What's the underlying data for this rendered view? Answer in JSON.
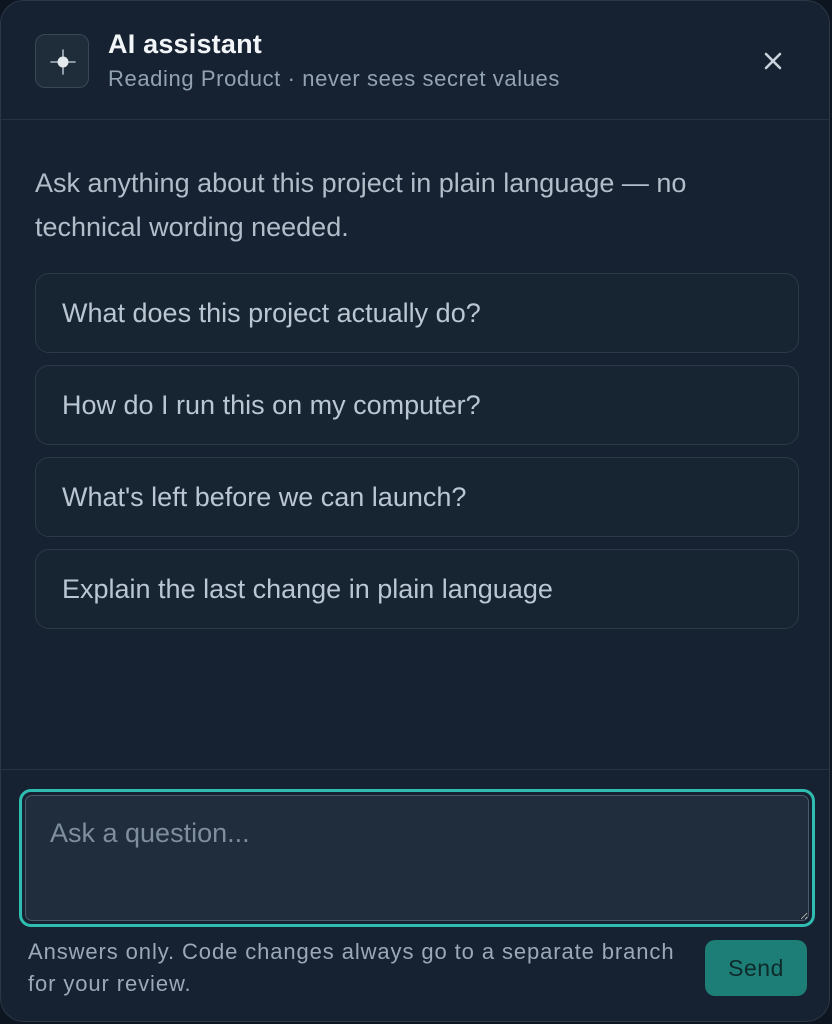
{
  "header": {
    "title": "AI assistant",
    "subtitle": "Reading Product · never sees secret values",
    "logo_icon": "sparkle-icon",
    "close_icon": "close-icon"
  },
  "intro": "Ask anything about this project in plain language — no technical wording needed.",
  "suggestions": [
    "What does this project actually do?",
    "How do I run this on my computer?",
    "What's left before we can launch?",
    "Explain the last change in plain language"
  ],
  "composer": {
    "placeholder": "Ask a question...",
    "value": "",
    "note": "Answers only. Code changes always go to a separate branch for your review.",
    "send_label": "Send"
  },
  "colors": {
    "panel_background": "#162231",
    "accent_focus_ring": "#2ebdb0",
    "send_button": "#1d7d77"
  }
}
